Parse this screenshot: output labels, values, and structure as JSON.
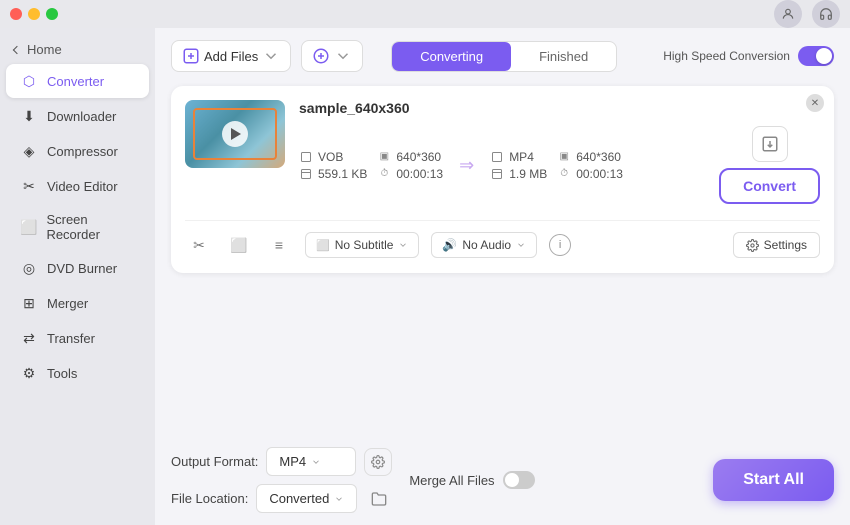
{
  "titlebar": {
    "lights": [
      "close",
      "minimize",
      "maximize"
    ]
  },
  "sidebar": {
    "home_label": "Home",
    "items": [
      {
        "id": "converter",
        "label": "Converter",
        "icon": "⬡",
        "active": true
      },
      {
        "id": "downloader",
        "label": "Downloader",
        "icon": "⬇"
      },
      {
        "id": "compressor",
        "label": "Compressor",
        "icon": "◈"
      },
      {
        "id": "video-editor",
        "label": "Video Editor",
        "icon": "✂"
      },
      {
        "id": "screen-recorder",
        "label": "Screen Recorder",
        "icon": "⬜"
      },
      {
        "id": "dvd-burner",
        "label": "DVD Burner",
        "icon": "◎"
      },
      {
        "id": "merger",
        "label": "Merger",
        "icon": "⊞"
      },
      {
        "id": "transfer",
        "label": "Transfer",
        "icon": "⇄"
      },
      {
        "id": "tools",
        "label": "Tools",
        "icon": "⚙"
      }
    ]
  },
  "topbar": {
    "add_files_label": "Add Files",
    "add_btn_label": "",
    "tabs": [
      {
        "id": "converting",
        "label": "Converting",
        "active": true
      },
      {
        "id": "finished",
        "label": "Finished",
        "active": false
      }
    ],
    "speed_label": "High Speed Conversion",
    "speed_enabled": true
  },
  "file_card": {
    "filename": "sample_640x360",
    "source": {
      "format": "VOB",
      "size": "559.1 KB",
      "resolution": "640*360",
      "duration": "00:00:13"
    },
    "target": {
      "format": "MP4",
      "size": "1.9 MB",
      "resolution": "640*360",
      "duration": "00:00:13"
    },
    "subtitle_label": "No Subtitle",
    "audio_label": "No Audio",
    "settings_label": "Settings",
    "convert_label": "Convert"
  },
  "bottom": {
    "output_format_label": "Output Format:",
    "output_format_value": "MP4",
    "file_location_label": "File Location:",
    "file_location_value": "Converted",
    "merge_label": "Merge All Files",
    "start_label": "Start All"
  }
}
